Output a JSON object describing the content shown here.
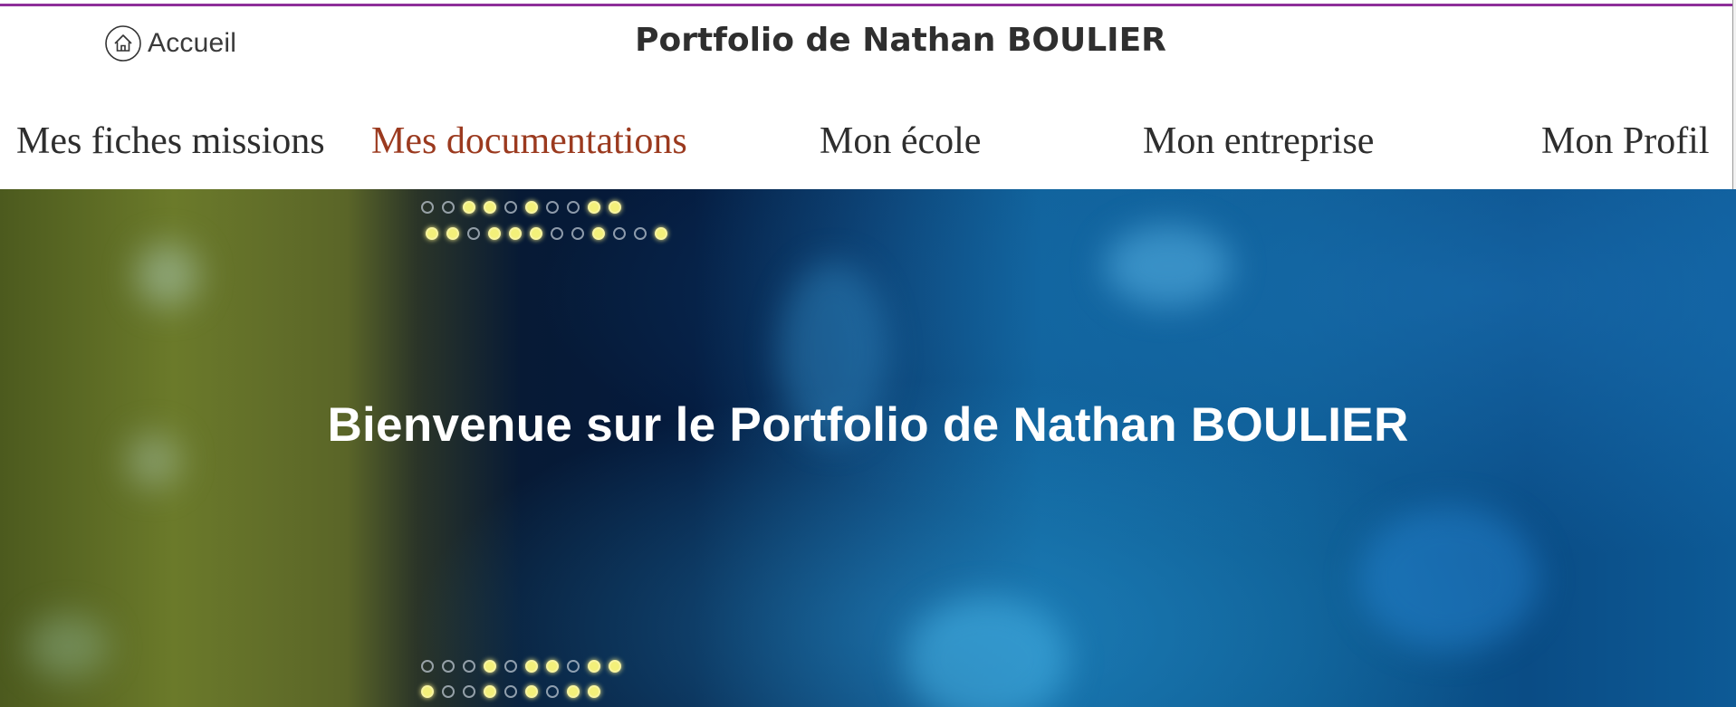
{
  "header": {
    "home_label": "Accueil",
    "home_icon": "home-icon",
    "site_title": "Portfolio de Nathan BOULIER",
    "accent_color": "#8e2f9a"
  },
  "nav": {
    "items": [
      {
        "label": "Mes fiches missions"
      },
      {
        "label": "Mes documentations"
      },
      {
        "label": "Mon école"
      },
      {
        "label": "Mon entreprise"
      },
      {
        "label": "Mon Profil"
      }
    ],
    "active_color": "#9b3a1f"
  },
  "hero": {
    "title": "Bienvenue sur le Portfolio de Nathan BOULIER"
  }
}
